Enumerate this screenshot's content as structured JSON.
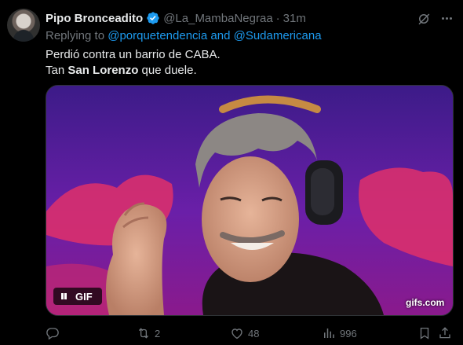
{
  "tweet": {
    "author_name": "Pipo Bronceadito",
    "handle": "@La_MambaNegraa",
    "separator": "·",
    "time": "31m",
    "replying_prefix": "Replying to",
    "replying_to_1": "@porquetendencia",
    "replying_and": "and",
    "replying_to_2": "@Sudamericana",
    "line1": "Perdió contra un barrio de CABA.",
    "line2_before": "Tan",
    "line2_bold": "San Lorenzo",
    "line2_after": "que duele.",
    "media": {
      "badge_label": "GIF",
      "watermark": "gifs.com"
    },
    "actions": {
      "reply_count": "",
      "retweet_count": "2",
      "like_count": "48",
      "views_count": "996"
    }
  },
  "colors": {
    "background": "#000000",
    "text_primary": "#e7e9ea",
    "text_secondary": "#71767b",
    "link": "#1d9bf0",
    "verified": "#1d9bf0",
    "media_bg": "#4a1a8e"
  },
  "icons": [
    "verified-icon",
    "grok-icon",
    "more-icon",
    "pause-icon",
    "reply-icon",
    "retweet-icon",
    "like-icon",
    "views-icon",
    "bookmark-icon",
    "share-icon"
  ]
}
